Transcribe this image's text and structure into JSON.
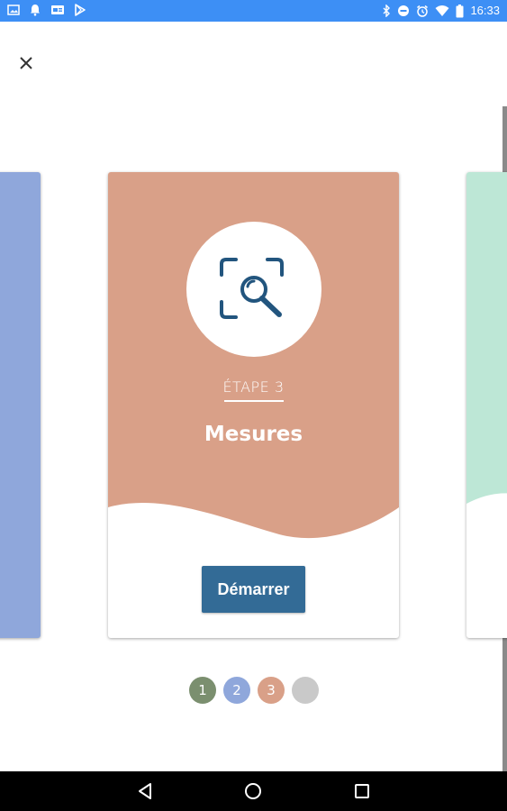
{
  "status_bar": {
    "time": "16:33",
    "left_icons": [
      "gallery-icon",
      "notification-bell-icon",
      "card-icon",
      "play-store-icon"
    ],
    "right_icons": [
      "bluetooth-icon",
      "do-not-disturb-icon",
      "alarm-icon",
      "wifi-icon",
      "battery-icon"
    ],
    "background": "#3d8ff5"
  },
  "carousel": {
    "current_step": {
      "step_label": "ÉTAPE 3",
      "title": "Mesures",
      "button_label": "Démarrer",
      "icon": "measure-scan-icon",
      "color": "#d9a088"
    },
    "prev_card_color": "#8fa7db",
    "next_card_color": "#bde7d6",
    "dots": [
      {
        "label": "1",
        "color": "#7b8f6f"
      },
      {
        "label": "2",
        "color": "#8fa7db"
      },
      {
        "label": "3",
        "color": "#d9a088"
      },
      {
        "label": "",
        "color": "#c9c9c9"
      }
    ]
  },
  "nav_bar": {
    "buttons": [
      "back-icon",
      "home-icon",
      "recents-icon"
    ]
  }
}
